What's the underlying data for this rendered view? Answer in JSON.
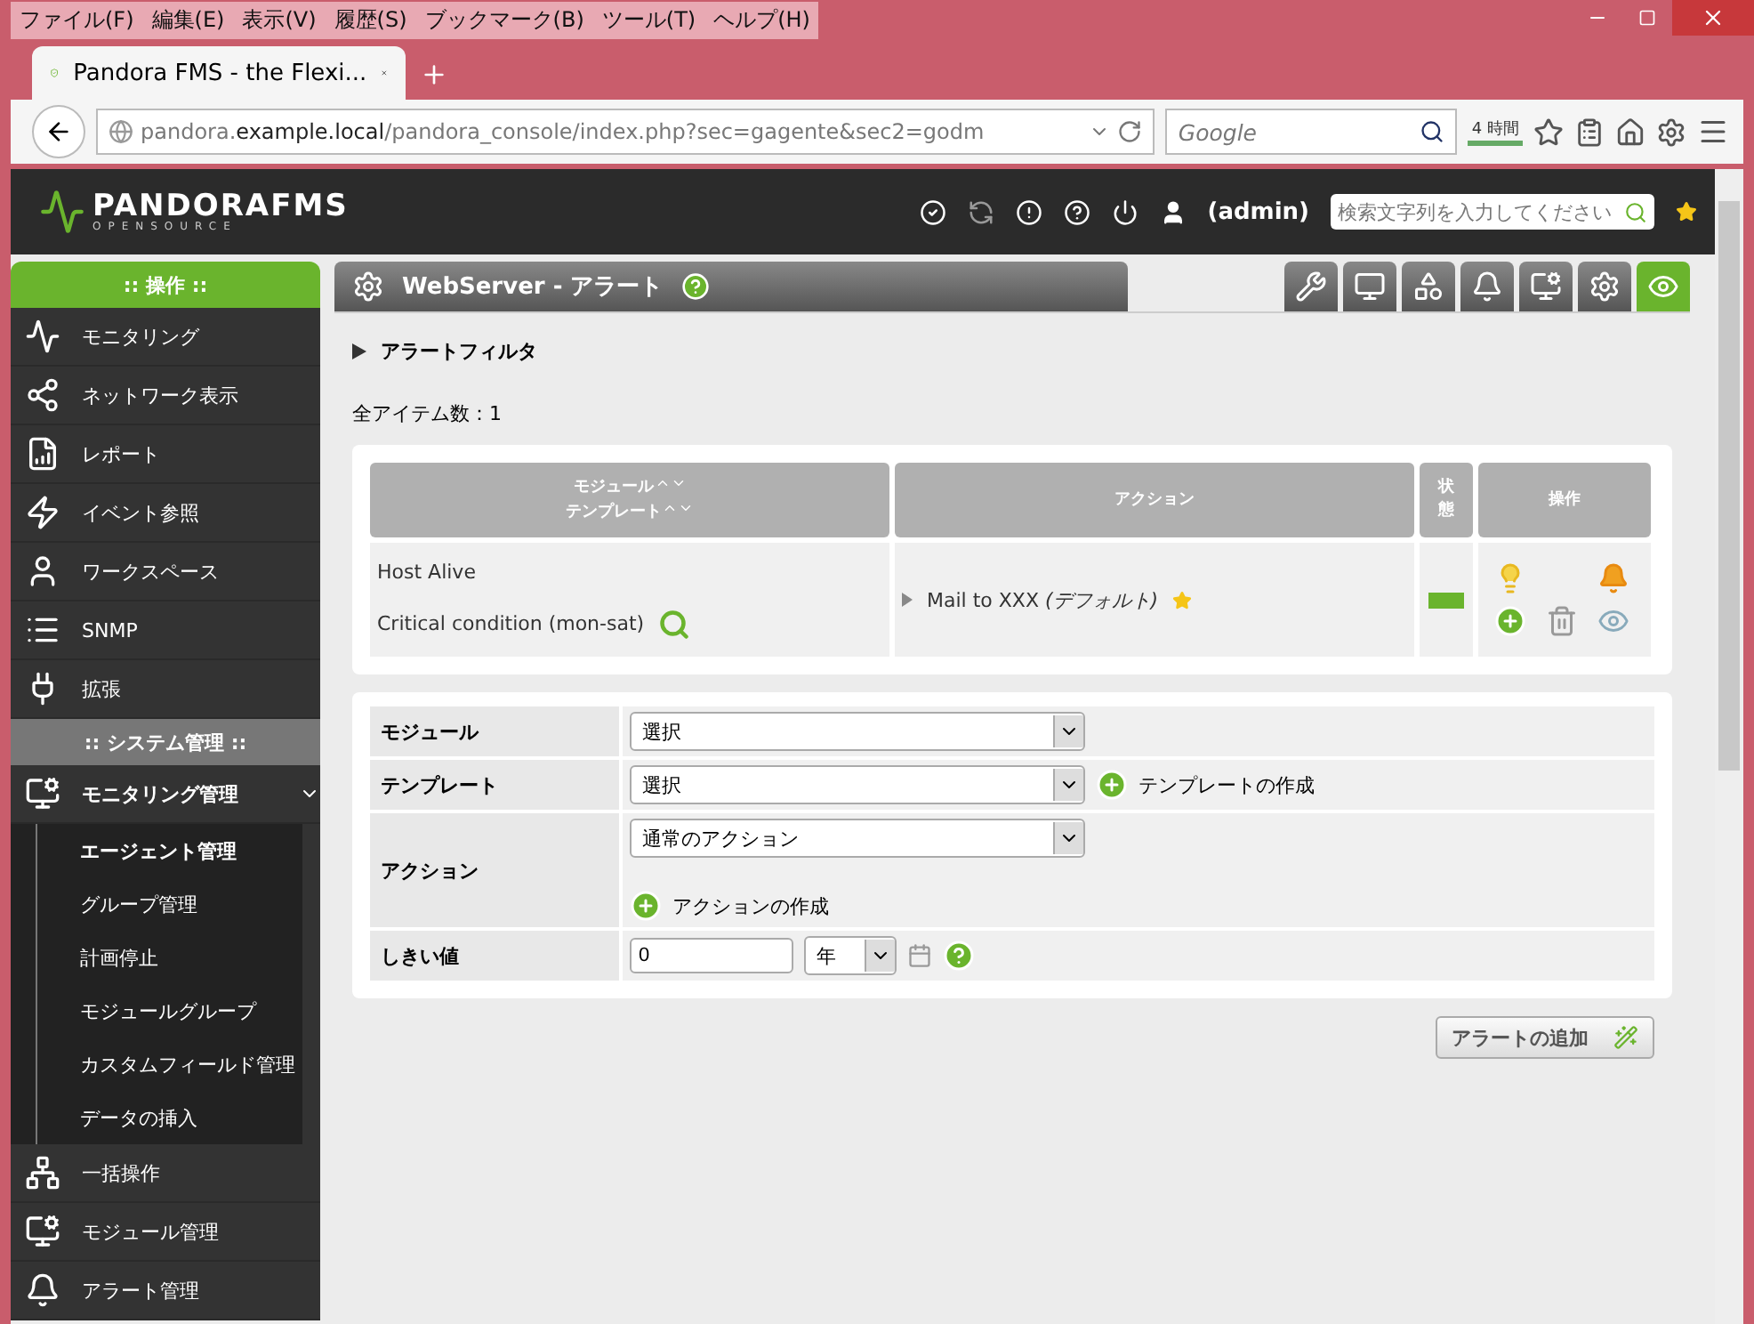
{
  "window": {
    "menu": [
      "ファイル(F)",
      "編集(E)",
      "表示(V)",
      "履歴(S)",
      "ブックマーク(B)",
      "ツール(T)",
      "ヘルプ(H)"
    ],
    "tab_title": "Pandora FMS - the Flexi...",
    "url": {
      "host_pre": "pandora.",
      "host": "example.local",
      "path": "/pandora_console/index.php?sec=gagente&sec2=godm"
    },
    "search_placeholder": "Google",
    "time_badge": "4 時間"
  },
  "header": {
    "logo": "PANDORAFMS",
    "logo_sub": "OPENSOURCE",
    "user": "(admin)",
    "search_placeholder": "検索文字列を入力してください"
  },
  "sidebar": [
    {
      "title": ":: 操作 ::",
      "selected": true,
      "items": [
        {
          "label": "モニタリング",
          "expanded": false
        },
        {
          "label": "ネットワーク表示",
          "expanded": false
        },
        {
          "label": "レポート",
          "expanded": false
        },
        {
          "label": "イベント参照",
          "expanded": false
        },
        {
          "label": "ワークスペース",
          "expanded": false
        },
        {
          "label": "SNMP",
          "expanded": false
        },
        {
          "label": "拡張",
          "expanded": false
        }
      ]
    },
    {
      "title": ":: システム管理 ::",
      "selected": false,
      "items": [
        {
          "label": "モニタリング管理",
          "expanded": true,
          "children": [
            {
              "label": "エージェント管理",
              "selected": true
            },
            {
              "label": "グループ管理",
              "selected": false
            },
            {
              "label": "計画停止",
              "selected": false
            },
            {
              "label": "モジュールグループ",
              "selected": false
            },
            {
              "label": "カスタムフィールド管理",
              "selected": false
            },
            {
              "label": "データの挿入",
              "selected": false
            }
          ]
        },
        {
          "label": "一括操作",
          "expanded": false
        },
        {
          "label": "モジュール管理",
          "expanded": false
        },
        {
          "label": "アラート管理",
          "expanded": false
        }
      ]
    }
  ],
  "page": {
    "title": "WebServer - アラート",
    "toolbar": [
      {
        "selected": false
      },
      {
        "selected": false
      },
      {
        "selected": false
      },
      {
        "selected": false
      },
      {
        "selected": false
      },
      {
        "selected": false
      },
      {
        "selected": true
      }
    ],
    "filter": {
      "label": "アラートフィルタ",
      "expanded": false
    },
    "count": "全アイテム数：1",
    "table": {
      "columns": [
        {
          "lines": [
            "モジュール",
            "テンプレート"
          ]
        },
        {
          "lines": [
            "アクション"
          ]
        },
        {
          "lines": [
            "状",
            "態"
          ]
        },
        {
          "lines": [
            "操作"
          ]
        }
      ],
      "rows": [
        {
          "module": "Host Alive",
          "template": "Critical condition (mon-sat)",
          "action": "Mail to XXX",
          "action_note": "(デフォルト)",
          "color": "#6ab42d"
        }
      ]
    },
    "form": [
      {
        "kind": "select",
        "label": "モジュール",
        "value": "選択"
      },
      {
        "kind": "select",
        "label": "テンプレート",
        "value": "選択",
        "link": "テンプレートの作成"
      },
      {
        "kind": "select",
        "label": "アクション",
        "value": "通常のアクション",
        "link_below": "アクションの作成"
      },
      {
        "kind": "threshold",
        "label": "しきい値",
        "value": "0",
        "unit": "年"
      }
    ],
    "submit": "アラートの追加"
  }
}
